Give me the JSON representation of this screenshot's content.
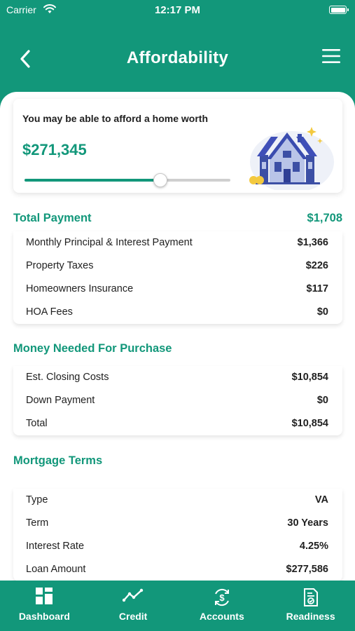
{
  "status_bar": {
    "carrier": "Carrier",
    "time": "12:17 PM"
  },
  "nav": {
    "title": "Affordability"
  },
  "hero": {
    "subtitle": "You may be able to afford a home worth",
    "amount": "$271,345",
    "slider_fraction": 0.66
  },
  "total_payment": {
    "header": "Total Payment",
    "total": "$1,708",
    "rows": [
      {
        "label": "Monthly Principal & Interest Payment",
        "value": "$1,366"
      },
      {
        "label": "Property Taxes",
        "value": "$226"
      },
      {
        "label": "Homeowners Insurance",
        "value": "$117"
      },
      {
        "label": "HOA Fees",
        "value": "$0"
      }
    ]
  },
  "money_needed": {
    "header": "Money Needed For Purchase",
    "rows": [
      {
        "label": "Est. Closing Costs",
        "value": "$10,854"
      },
      {
        "label": "Down Payment",
        "value": "$0"
      },
      {
        "label": "Total",
        "value": "$10,854"
      }
    ]
  },
  "mortgage_terms": {
    "header": "Mortgage Terms",
    "rows": [
      {
        "label": "Type",
        "value": "VA"
      },
      {
        "label": "Term",
        "value": "30  Years"
      },
      {
        "label": "Interest Rate",
        "value": "4.25%"
      },
      {
        "label": "Loan Amount",
        "value": "$277,586"
      }
    ]
  },
  "tabs": [
    {
      "label": "Dashboard",
      "icon": "dashboard-icon"
    },
    {
      "label": "Credit",
      "icon": "credit-trend-icon"
    },
    {
      "label": "Accounts",
      "icon": "accounts-dollar-icon"
    },
    {
      "label": "Readiness",
      "icon": "readiness-document-icon"
    }
  ],
  "colors": {
    "brand": "#12977a",
    "text": "#1f1f1f",
    "background": "#ffffff"
  }
}
